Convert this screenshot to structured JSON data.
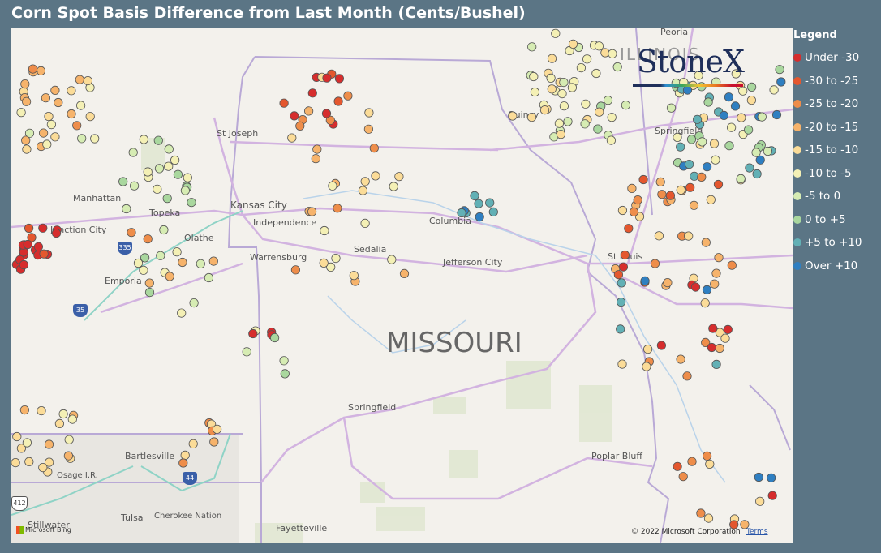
{
  "title": "Corn Spot Basis Difference from Last Month (Cents/Bushel)",
  "legend": {
    "title": "Legend",
    "items": [
      {
        "label": "Under -30",
        "color": "#d62d2d"
      },
      {
        "label": "-30 to -25",
        "color": "#e4572e"
      },
      {
        "label": "-25 to -20",
        "color": "#ee8d4a"
      },
      {
        "label": "-20 to -15",
        "color": "#f6b36b"
      },
      {
        "label": "-15 to -10",
        "color": "#fbdc98"
      },
      {
        "label": "-10 to -5",
        "color": "#f4f0b5"
      },
      {
        "label": "-5 to 0",
        "color": "#d6ecb3"
      },
      {
        "label": "0 to +5",
        "color": "#a9d79e"
      },
      {
        "label": "+5 to +10",
        "color": "#62b0b5"
      },
      {
        "label": "Over +10",
        "color": "#2f7fc1"
      }
    ]
  },
  "logo": {
    "text": "StoneX"
  },
  "state_label": "MISSOURI",
  "places": [
    {
      "name": "St Joseph"
    },
    {
      "name": "Manhattan"
    },
    {
      "name": "Topeka"
    },
    {
      "name": "Junction City"
    },
    {
      "name": "Kansas City"
    },
    {
      "name": "Independence"
    },
    {
      "name": "Olathe"
    },
    {
      "name": "Emporia"
    },
    {
      "name": "Warrensburg"
    },
    {
      "name": "Sedalia"
    },
    {
      "name": "Columbia"
    },
    {
      "name": "Jefferson City"
    },
    {
      "name": "St Louis"
    },
    {
      "name": "Springfield"
    },
    {
      "name": "Poplar Bluff"
    },
    {
      "name": "Bartlesville"
    },
    {
      "name": "Osage I.R."
    },
    {
      "name": "Tulsa"
    },
    {
      "name": "Cherokee Nation"
    },
    {
      "name": "Stillwater"
    },
    {
      "name": "Fayetteville"
    },
    {
      "name": "Quincy"
    },
    {
      "name": "Springfield"
    },
    {
      "name": "Peoria"
    },
    {
      "name": "ILLINOIS"
    }
  ],
  "highways": [
    "35",
    "335",
    "44",
    "412"
  ],
  "attribution": {
    "bing": "Microsoft Bing",
    "copyright": "© 2022 Microsoft Corporation",
    "terms": "Terms"
  }
}
